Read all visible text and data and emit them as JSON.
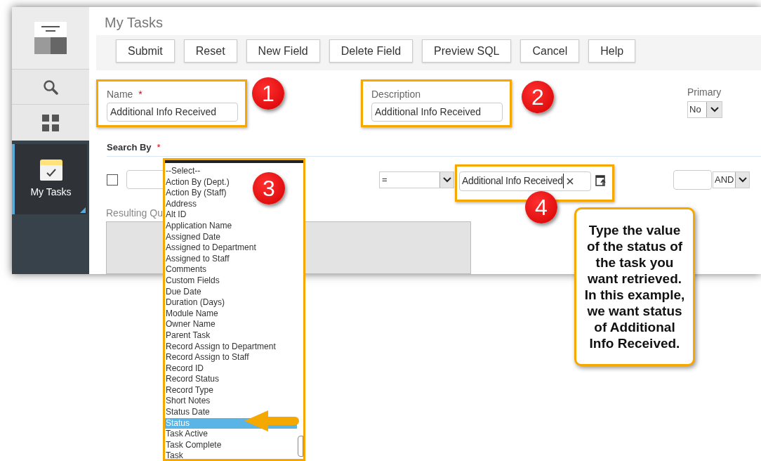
{
  "sidebar": {
    "items": [
      {
        "kind": "search",
        "selected": false
      },
      {
        "kind": "apps",
        "selected": false
      },
      {
        "kind": "tasks",
        "label": "My Tasks",
        "selected": true
      }
    ]
  },
  "page_title": "My Tasks",
  "toolbar_buttons": [
    "Submit",
    "Reset",
    "New Field",
    "Delete Field",
    "Preview SQL",
    "Cancel",
    "Help"
  ],
  "form": {
    "name": {
      "label": "Name",
      "required_mark": "*",
      "value": "Additional Info Received"
    },
    "description": {
      "label": "Description",
      "value": "Additional Info Received"
    },
    "primary": {
      "label": "Primary",
      "value": "No"
    }
  },
  "search_by": {
    "label": "Search By",
    "required_mark": "*"
  },
  "criteria_row": {
    "checked": false,
    "operator": "=",
    "value": "Additional Info Received",
    "join": "AND"
  },
  "resulting_query": {
    "label": "Resulting Qu"
  },
  "field_dropdown": {
    "options": [
      {
        "label": "--Select--",
        "selected": false
      },
      {
        "label": "Action By (Dept.)",
        "selected": false
      },
      {
        "label": "Action By (Staff)",
        "selected": false
      },
      {
        "label": "Address",
        "selected": false
      },
      {
        "label": "Alt ID",
        "selected": false
      },
      {
        "label": "Application Name",
        "selected": false
      },
      {
        "label": "Assigned Date",
        "selected": false
      },
      {
        "label": "Assigned to Department",
        "selected": false
      },
      {
        "label": "Assigned to Staff",
        "selected": false
      },
      {
        "label": "Comments",
        "selected": false
      },
      {
        "label": "Custom Fields",
        "selected": false
      },
      {
        "label": "Due Date",
        "selected": false
      },
      {
        "label": "Duration (Days)",
        "selected": false
      },
      {
        "label": "Module Name",
        "selected": false
      },
      {
        "label": "Owner Name",
        "selected": false
      },
      {
        "label": "Parent Task",
        "selected": false
      },
      {
        "label": "Record Assign to Department",
        "selected": false
      },
      {
        "label": "Record Assign to Staff",
        "selected": false
      },
      {
        "label": "Record ID",
        "selected": false
      },
      {
        "label": "Record Status",
        "selected": false
      },
      {
        "label": "Record Type",
        "selected": false
      },
      {
        "label": "Short Notes",
        "selected": false
      },
      {
        "label": "Status Date",
        "selected": false
      },
      {
        "label": "Status",
        "selected": true
      },
      {
        "label": "Task Active",
        "selected": false
      },
      {
        "label": "Task Complete",
        "selected": false
      },
      {
        "label": "Task",
        "selected": false
      }
    ]
  },
  "annotations": {
    "markers": [
      {
        "label": "1"
      },
      {
        "label": "2"
      },
      {
        "label": "3"
      },
      {
        "label": "4"
      }
    ],
    "callout": "Type the value of the status of the task you want retrieved. In this example, we want status of Additional Info Received."
  }
}
